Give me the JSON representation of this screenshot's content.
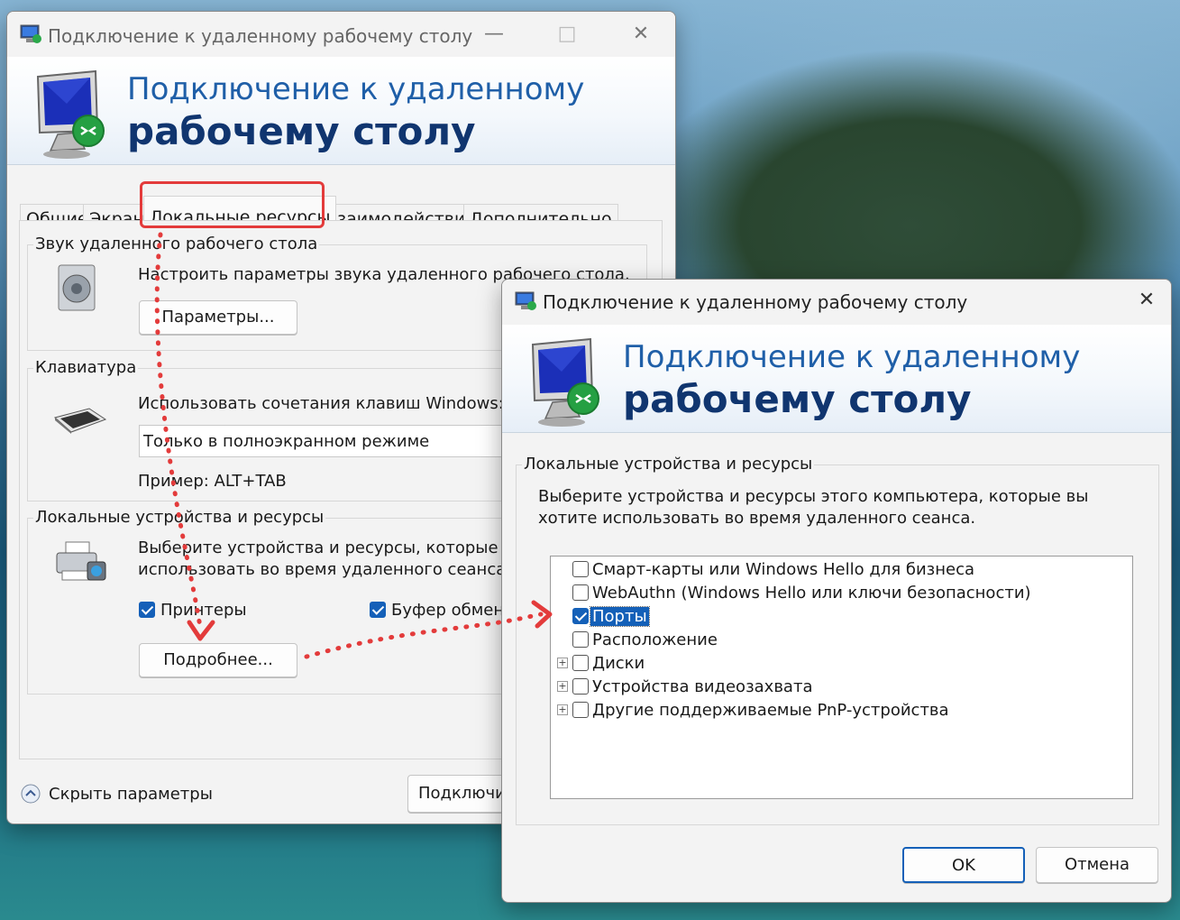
{
  "main_window": {
    "title": "Подключение к удаленному рабочему столу",
    "banner_line1": "Подключение к удаленному",
    "banner_line2": "рабочему столу",
    "tabs": [
      {
        "label": "Общие"
      },
      {
        "label": "Экран"
      },
      {
        "label": "Локальные ресурсы"
      },
      {
        "label": "Взаимодействие"
      },
      {
        "label": "Дополнительно"
      }
    ],
    "sound_group": {
      "title": "Звук удаленного рабочего стола",
      "description": "Настроить параметры звука удаленного рабочего стола.",
      "params_button": "Параметры..."
    },
    "keyboard_group": {
      "title": "Клавиатура",
      "description": "Использовать сочетания клавиш Windows:",
      "mode_value": "Только в полноэкранном режиме",
      "example": "Пример: ALT+TAB"
    },
    "local_group": {
      "title": "Локальные устройства и ресурсы",
      "description_line1": "Выберите устройства и ресурсы, которые вы",
      "description_line2": "использовать во время удаленного сеанса.",
      "printers_label": "Принтеры",
      "clipboard_label": "Буфер обмена",
      "more_button": "Подробнее..."
    },
    "hide_params": "Скрыть параметры",
    "connect_button": "Подключить"
  },
  "dialog": {
    "title": "Подключение к удаленному рабочему столу",
    "banner_line1": "Подключение к удаленному",
    "banner_line2": "рабочему столу",
    "group_title": "Локальные устройства и ресурсы",
    "description_line1": "Выберите устройства и ресурсы этого компьютера, которые вы",
    "description_line2": "хотите использовать во время удаленного сеанса.",
    "items": [
      {
        "label": "Смарт-карты или Windows Hello для бизнеса",
        "checked": false,
        "expandable": false
      },
      {
        "label": "WebAuthn (Windows Hello или ключи безопасности)",
        "checked": false,
        "expandable": false
      },
      {
        "label": "Порты",
        "checked": true,
        "expandable": false,
        "selected": true
      },
      {
        "label": "Расположение",
        "checked": false,
        "expandable": false
      },
      {
        "label": "Диски",
        "checked": false,
        "expandable": true
      },
      {
        "label": "Устройства видеозахвата",
        "checked": false,
        "expandable": true
      },
      {
        "label": "Другие поддерживаемые PnP-устройства",
        "checked": false,
        "expandable": true
      }
    ],
    "ok_button": "OK",
    "cancel_button": "Отмена"
  },
  "colors": {
    "annotation_red": "#e33b3b",
    "accent_blue": "#1460b8",
    "banner_title_blue": "#1f5fa8",
    "banner_bold_navy": "#10356f"
  }
}
